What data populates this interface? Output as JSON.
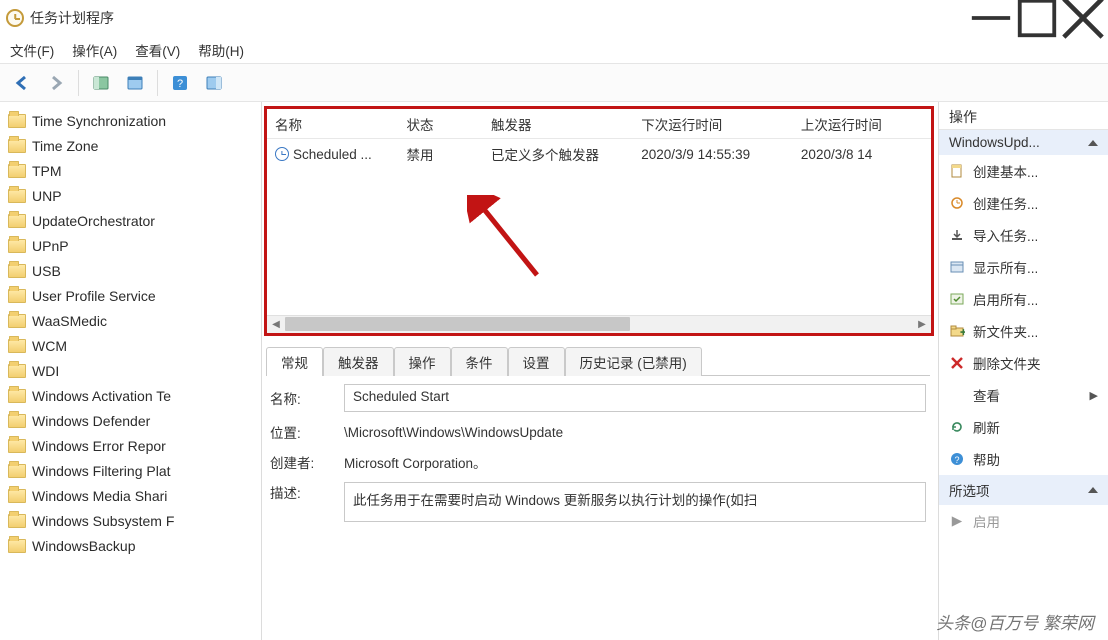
{
  "window": {
    "title": "任务计划程序"
  },
  "menu": {
    "file": "文件(F)",
    "action": "操作(A)",
    "view": "查看(V)",
    "help": "帮助(H)"
  },
  "tree": {
    "items": [
      "Time Synchronization",
      "Time Zone",
      "TPM",
      "UNP",
      "UpdateOrchestrator",
      "UPnP",
      "USB",
      "User Profile Service",
      "WaaSMedic",
      "WCM",
      "WDI",
      "Windows Activation Te",
      "Windows Defender",
      "Windows Error Repor",
      "Windows Filtering Plat",
      "Windows Media Shari",
      "Windows Subsystem F",
      "WindowsBackup"
    ]
  },
  "tasklist": {
    "columns": {
      "name": "名称",
      "status": "状态",
      "triggers": "触发器",
      "next_run": "下次运行时间",
      "last_run": "上次运行时间"
    },
    "row": {
      "name": "Scheduled ...",
      "status": "禁用",
      "triggers": "已定义多个触发器",
      "next_run": "2020/3/9 14:55:39",
      "last_run": "2020/3/8 14"
    }
  },
  "details": {
    "tabs": {
      "general": "常规",
      "triggers": "触发器",
      "actions": "操作",
      "conditions": "条件",
      "settings": "设置",
      "history": "历史记录 (已禁用)"
    },
    "name_label": "名称:",
    "name_value": "Scheduled Start",
    "location_label": "位置:",
    "location_value": "\\Microsoft\\Windows\\WindowsUpdate",
    "author_label": "创建者:",
    "author_value": "Microsoft Corporation。",
    "description_label": "描述:",
    "description_value": "此任务用于在需要时启动 Windows 更新服务以执行计划的操作(如扫"
  },
  "actions": {
    "header": "操作",
    "section1_title": "WindowsUpd...",
    "items": [
      {
        "icon": "doc",
        "label": "创建基本..."
      },
      {
        "icon": "newtask",
        "label": "创建任务..."
      },
      {
        "icon": "import",
        "label": "导入任务..."
      },
      {
        "icon": "showall",
        "label": "显示所有..."
      },
      {
        "icon": "enableall",
        "label": "启用所有..."
      },
      {
        "icon": "newfolder",
        "label": "新文件夹..."
      },
      {
        "icon": "delete",
        "label": "删除文件夹"
      },
      {
        "icon": "view",
        "label": "查看",
        "chevron": true
      },
      {
        "icon": "refresh",
        "label": "刷新"
      },
      {
        "icon": "help",
        "label": "帮助"
      }
    ],
    "section2_title": "所选项",
    "selected_item": "启用"
  },
  "watermark": "头条@百万号   繁荣网"
}
